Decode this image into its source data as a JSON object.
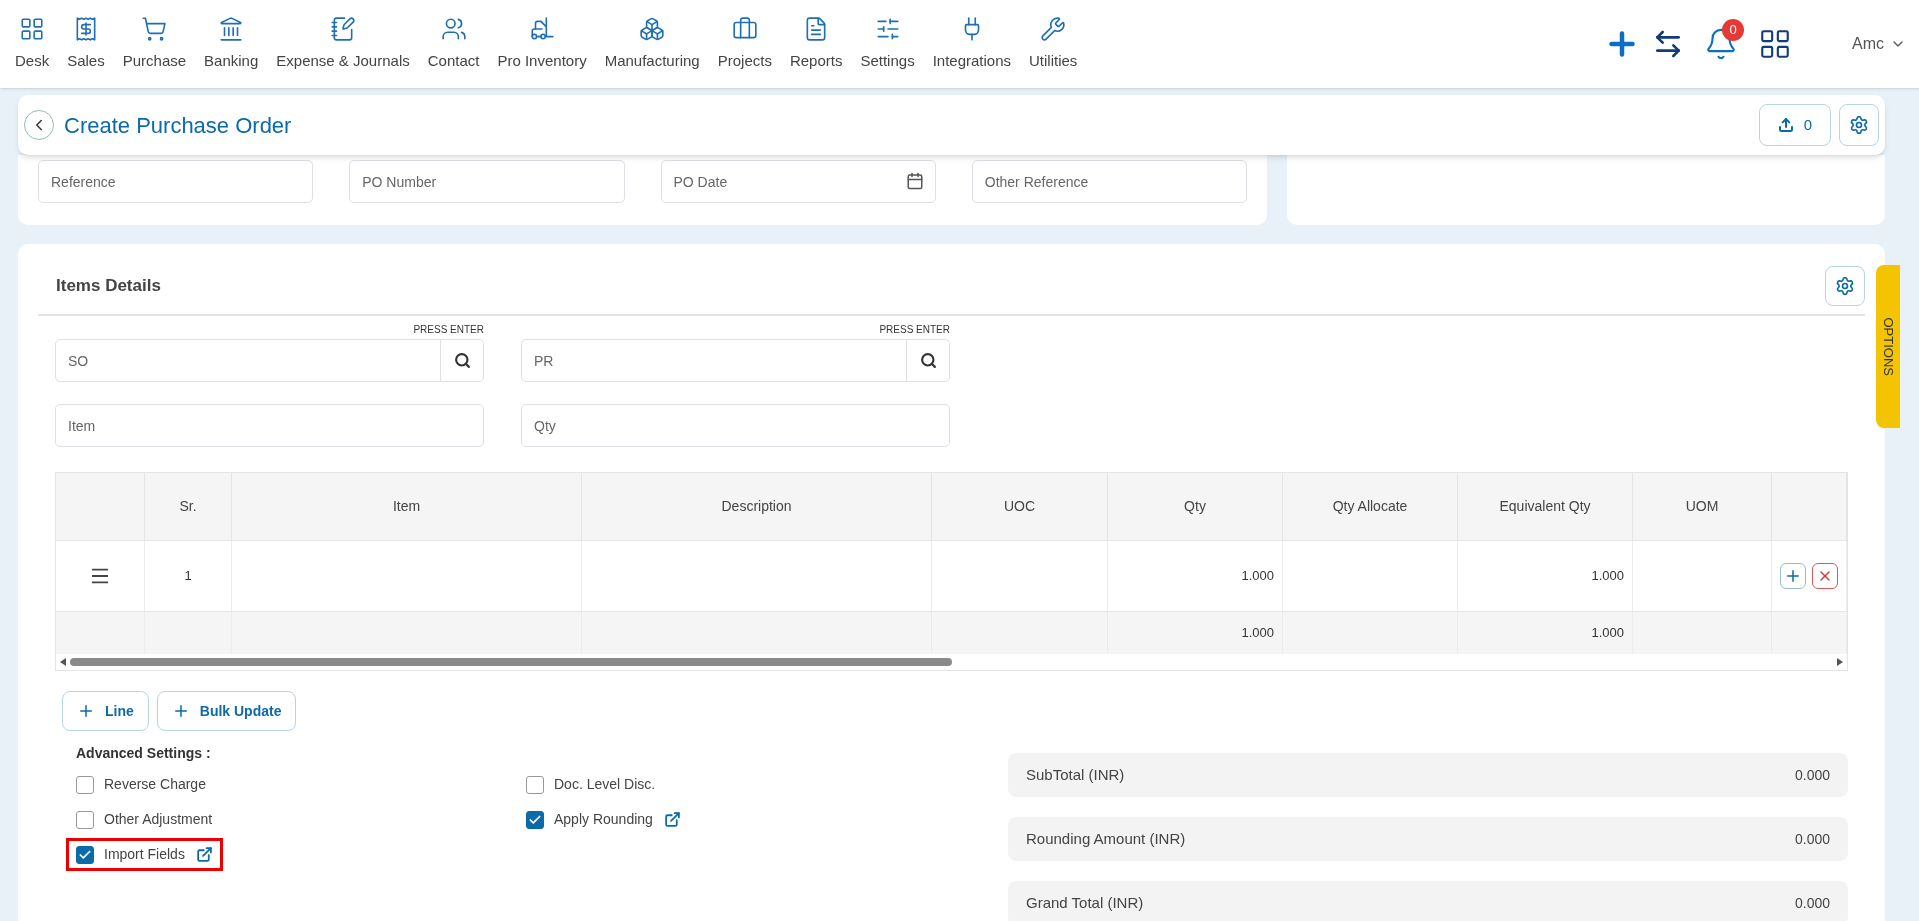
{
  "nav": {
    "items": [
      {
        "label": "Desk"
      },
      {
        "label": "Sales"
      },
      {
        "label": "Purchase"
      },
      {
        "label": "Banking"
      },
      {
        "label": "Expense & Journals"
      },
      {
        "label": "Contact"
      },
      {
        "label": "Pro Inventory"
      },
      {
        "label": "Manufacturing"
      },
      {
        "label": "Projects"
      },
      {
        "label": "Reports"
      },
      {
        "label": "Settings"
      },
      {
        "label": "Integrations"
      },
      {
        "label": "Utilities"
      }
    ],
    "notification_count": "0",
    "user": "Amc"
  },
  "header": {
    "title": "Create Purchase Order",
    "upload_count": "0"
  },
  "reference_fields": [
    {
      "placeholder": "Reference",
      "kind": "text"
    },
    {
      "placeholder": "PO Number",
      "kind": "text"
    },
    {
      "placeholder": "PO Date",
      "kind": "date"
    },
    {
      "placeholder": "Other Reference",
      "kind": "text"
    }
  ],
  "items_details": {
    "title": "Items Details",
    "search_fields": [
      {
        "placeholder": "SO",
        "hint": "PRESS ENTER"
      },
      {
        "placeholder": "PR",
        "hint": "PRESS ENTER"
      }
    ],
    "entry_fields": [
      {
        "placeholder": "Item"
      },
      {
        "placeholder": "Qty"
      }
    ],
    "table": {
      "columns": {
        "sr": "Sr.",
        "item": "Item",
        "description": "Description",
        "uoc": "UOC",
        "qty": "Qty",
        "qty_allocate": "Qty Allocate",
        "equivalent_qty": "Equivalent Qty",
        "uom": "UOM"
      },
      "rows": [
        {
          "sr": "1",
          "qty": "1.000",
          "equivalent_qty": "1.000"
        }
      ],
      "footer": {
        "qty": "1.000",
        "equivalent_qty": "1.000"
      }
    },
    "buttons": [
      "Line",
      "Bulk Update"
    ]
  },
  "advanced_settings": {
    "title": "Advanced Settings :",
    "options": [
      {
        "label": "Reverse Charge",
        "checked": false,
        "link": false,
        "highlighted": false
      },
      {
        "label": "Doc. Level Disc.",
        "checked": false,
        "link": false,
        "highlighted": false
      },
      {
        "label": "Other Adjustment",
        "checked": false,
        "link": false,
        "highlighted": false
      },
      {
        "label": "Apply Rounding",
        "checked": true,
        "link": true,
        "highlighted": false
      },
      {
        "label": "Import Fields",
        "checked": true,
        "link": true,
        "highlighted": true
      }
    ]
  },
  "totals": [
    {
      "label": "SubTotal (INR)",
      "value": "0.000"
    },
    {
      "label": "Rounding Amount (INR)",
      "value": "0.000"
    },
    {
      "label": "Grand Total (INR)",
      "value": "0.000"
    }
  ],
  "options_tab": "OPTIONS"
}
